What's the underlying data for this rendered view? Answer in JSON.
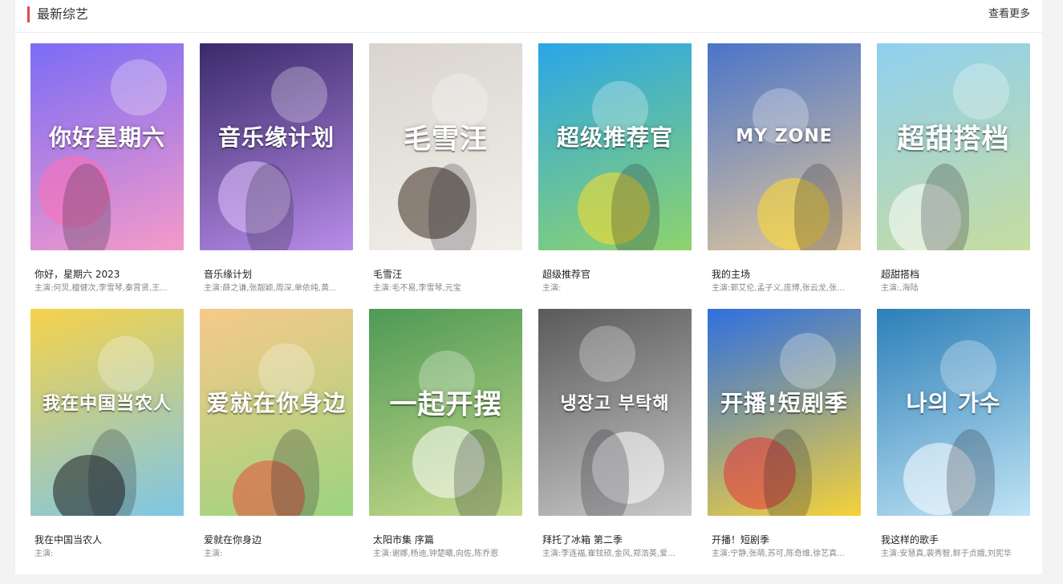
{
  "section": {
    "title": "最新综艺",
    "more_label": "查看更多",
    "accent_color": "#e5484d"
  },
  "cast_label": "主演:",
  "cards": [
    {
      "title": "你好，星期六 2023",
      "cast": "何炅,檀健次,李雪琴,秦霄贤,王...",
      "poster_text": "你好星期六",
      "bg": [
        "#7b6cf6",
        "#f59ac9"
      ],
      "accent": "#ff6fb5"
    },
    {
      "title": "音乐缘计划",
      "cast": "薛之谦,张靓颖,周深,单依纯,黄...",
      "poster_text": "音乐缘计划",
      "bg": [
        "#3a2a6a",
        "#b88ce8"
      ],
      "accent": "#e2c4ff"
    },
    {
      "title": "毛雪汪",
      "cast": "毛不易,李雪琴,元宝",
      "poster_text": "毛雪汪",
      "bg": [
        "#d9d4cf",
        "#f2efe9"
      ],
      "accent": "#3b2b1f"
    },
    {
      "title": "超级推荐官",
      "cast": "",
      "poster_text": "超级推荐官",
      "bg": [
        "#2aa6e8",
        "#8fd36c"
      ],
      "accent": "#ffdd2b"
    },
    {
      "title": "我的主场",
      "cast": "郭艾伦,孟子义,庞博,张云龙,张...",
      "poster_text": "MY ZONE",
      "bg": [
        "#4a74c9",
        "#e3c79b"
      ],
      "accent": "#ffdd2b"
    },
    {
      "title": "超甜搭档",
      "cast": ",海陆",
      "poster_text": "超甜搭档",
      "bg": [
        "#8fd0f0",
        "#c7dca0"
      ],
      "accent": "#ffffff"
    },
    {
      "title": "我在中国当农人",
      "cast": "",
      "poster_text": "我在中国当农人",
      "bg": [
        "#f6d24a",
        "#7ec6e6"
      ],
      "accent": "#1b1b1b"
    },
    {
      "title": "爱就在你身边",
      "cast": "",
      "poster_text": "爱就在你身边",
      "bg": [
        "#f7c98a",
        "#9bd47e"
      ],
      "accent": "#e84a3a"
    },
    {
      "title": "太阳市集 序篇",
      "cast": "谢娜,杨迪,钟楚曦,向佐,陈乔恩",
      "poster_text": "一起开摆",
      "bg": [
        "#4e9a55",
        "#c6d98a"
      ],
      "accent": "#ffffff"
    },
    {
      "title": "拜托了冰箱 第二季",
      "cast": "李连福,崔铉硕,金风,郑浩英,爱...",
      "poster_text": "냉장고 부탁해",
      "bg": [
        "#5a5a5a",
        "#c9c9c9"
      ],
      "accent": "#ffffff"
    },
    {
      "title": "开播！短剧季",
      "cast": "宁静,张萌,苏可,陈奇维,徐艺真...",
      "poster_text": "开播!短剧季",
      "bg": [
        "#2f6fe0",
        "#f5d23a"
      ],
      "accent": "#e8323a"
    },
    {
      "title": "我这样的歌手",
      "cast": "安慧真,裴秀智,鲜于贞娥,刘宪华",
      "poster_text": "나의 가수",
      "bg": [
        "#2c7fb8",
        "#bfe3f4"
      ],
      "accent": "#ffffff"
    }
  ]
}
